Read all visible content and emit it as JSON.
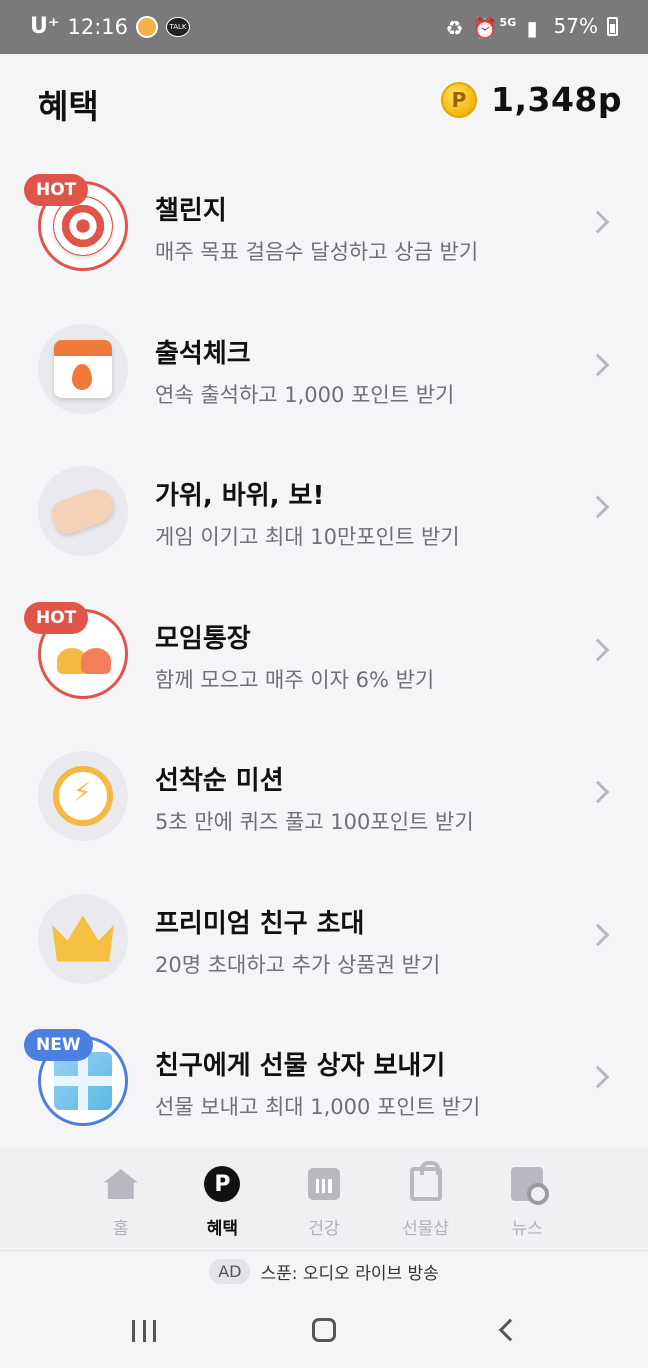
{
  "status_bar": {
    "carrier": "U⁺",
    "time": "12:16",
    "battery": "57%"
  },
  "header": {
    "title": "혜택",
    "points": "1,348p",
    "coin_letter": "P"
  },
  "items": [
    {
      "title": "챌린지",
      "subtitle": "매주 목표 걸음수 달성하고 상금 받기",
      "badge": "HOT",
      "icon": "target-icon"
    },
    {
      "title": "출석체크",
      "subtitle": "연속 출석하고 1,000 포인트 받기",
      "badge": "",
      "icon": "calendar-icon"
    },
    {
      "title": "가위, 바위, 보!",
      "subtitle": "게임 이기고 최대 10만포인트 받기",
      "badge": "",
      "icon": "hand-icon"
    },
    {
      "title": "모임통장",
      "subtitle": "함께 모으고 매주 이자 6% 받기",
      "badge": "HOT",
      "icon": "people-icon"
    },
    {
      "title": "선착순 미션",
      "subtitle": "5초 만에 퀴즈 풀고 100포인트 받기",
      "badge": "",
      "icon": "alarm-clock-icon"
    },
    {
      "title": "프리미엄 친구 초대",
      "subtitle": "20명 초대하고 추가 상품권 받기",
      "badge": "",
      "icon": "crown-icon"
    },
    {
      "title": "친구에게 선물 상자 보내기",
      "subtitle": "선물 보내고 최대 1,000 포인트 받기",
      "badge": "NEW",
      "icon": "gift-icon"
    }
  ],
  "bottom_nav": [
    {
      "label": "홈",
      "icon": "home-icon",
      "active": false
    },
    {
      "label": "혜택",
      "icon": "points-icon",
      "active": true
    },
    {
      "label": "건강",
      "icon": "chart-icon",
      "active": false
    },
    {
      "label": "선물샵",
      "icon": "shopping-bag-icon",
      "active": false
    },
    {
      "label": "뉴스",
      "icon": "news-icon",
      "active": false
    }
  ],
  "ad": {
    "tag": "AD",
    "text": "스푼: 오디오 라이브 방송"
  },
  "colors": {
    "hot": "#e0554a",
    "new": "#4d7fe0",
    "coin": "#f3b70c"
  }
}
